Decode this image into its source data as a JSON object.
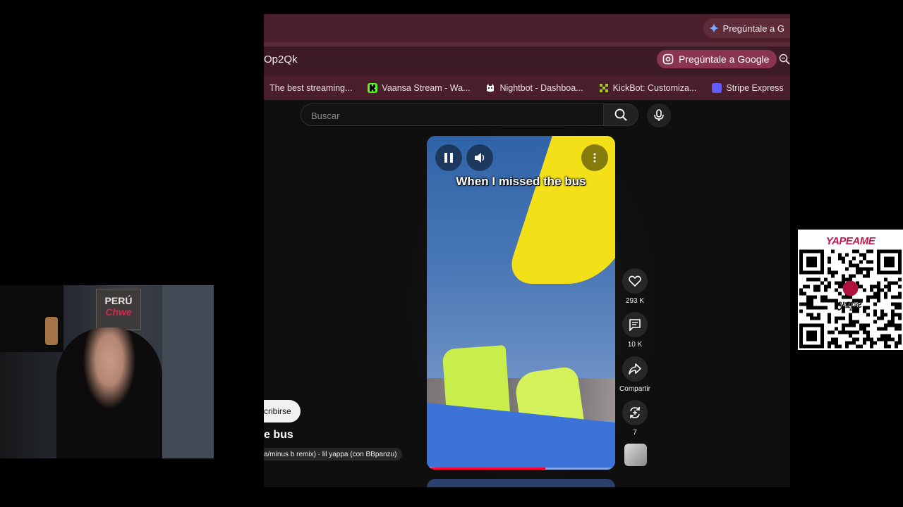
{
  "browser": {
    "tab_pill_label": "Pregúntale a G",
    "url_fragment": "Op2Qk",
    "ask_google_label": "Pregúntale a Google",
    "bookmarks": [
      {
        "label": "The best streaming...",
        "icon": "streaming-favicon",
        "color": "#4a1f2b"
      },
      {
        "label": "Vaansa Stream - Wa...",
        "icon": "kick-favicon",
        "color": "#53fc18"
      },
      {
        "label": "Nightbot - Dashboa...",
        "icon": "nightbot-favicon",
        "color": "#ffffff"
      },
      {
        "label": "KickBot: Customiza...",
        "icon": "kickbot-favicon",
        "color": "#9ad017"
      },
      {
        "label": "Stripe Express",
        "icon": "stripe-favicon",
        "color": "#635bff"
      }
    ]
  },
  "youtube": {
    "search_placeholder": "Buscar",
    "video": {
      "caption": "When I missed the bus",
      "progress": 0.63
    },
    "actions": {
      "likes": "293 K",
      "comments": "10 K",
      "share_label": "Compartir",
      "remix_count": "7"
    },
    "meta": {
      "subscribe_label": "cribirse",
      "title": "e bus",
      "sound": "a/minus b remix) · lil yappa (con BBpanzu)"
    }
  },
  "overlay": {
    "poster_line1": "PERÚ",
    "poster_line2": "Chwe",
    "qr_title": "YAPEAME",
    "qr_brand": "yape"
  },
  "colors": {
    "accent": "#ff0033",
    "tabstrip": "#4a1f2b",
    "ask_button": "#8a3550",
    "yape": "#c4174f"
  }
}
